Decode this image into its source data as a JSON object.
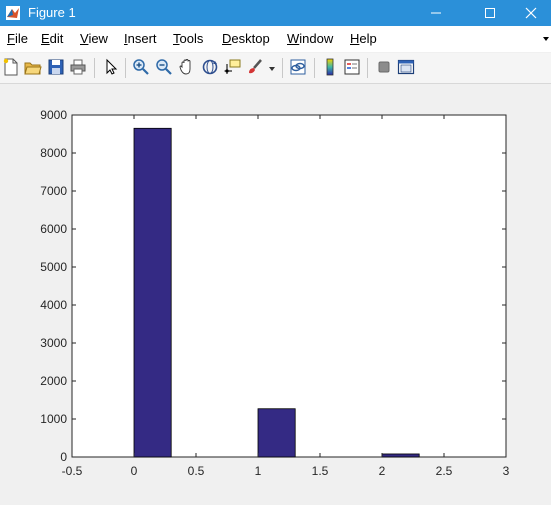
{
  "window": {
    "title": "Figure 1",
    "app_icon": "matlab-logo-icon",
    "controls": [
      "minimize-icon",
      "maximize-icon",
      "close-icon"
    ]
  },
  "menu": {
    "items": [
      {
        "label": "File",
        "mnemonic": "F"
      },
      {
        "label": "Edit",
        "mnemonic": "E"
      },
      {
        "label": "View",
        "mnemonic": "V"
      },
      {
        "label": "Insert",
        "mnemonic": "I"
      },
      {
        "label": "Tools",
        "mnemonic": "T"
      },
      {
        "label": "Desktop",
        "mnemonic": "D"
      },
      {
        "label": "Window",
        "mnemonic": "W"
      },
      {
        "label": "Help",
        "mnemonic": "H"
      }
    ]
  },
  "toolbar": {
    "icons": [
      "new-figure-icon",
      "open-file-icon",
      "save-icon",
      "print-icon",
      "select-arrow-icon",
      "zoom-in-icon",
      "zoom-out-icon",
      "pan-hand-icon",
      "rotate-3d-icon",
      "data-cursor-icon",
      "brush-icon",
      "link-plot-icon",
      "colorbar-icon",
      "legend-icon",
      "hide-plot-tools-icon",
      "show-plot-tools-icon"
    ]
  },
  "chart_data": {
    "type": "bar",
    "x": [
      0,
      1,
      2
    ],
    "values": [
      8650,
      1270,
      80
    ],
    "bar_color": "#342a84",
    "xlim": [
      -0.5,
      3
    ],
    "ylim": [
      0,
      9000
    ],
    "xticks": [
      "-0.5",
      "0",
      "0.5",
      "1",
      "1.5",
      "2",
      "2.5",
      "3"
    ],
    "yticks": [
      "0",
      "1000",
      "2000",
      "3000",
      "4000",
      "5000",
      "6000",
      "7000",
      "8000",
      "9000"
    ],
    "grid": false
  }
}
